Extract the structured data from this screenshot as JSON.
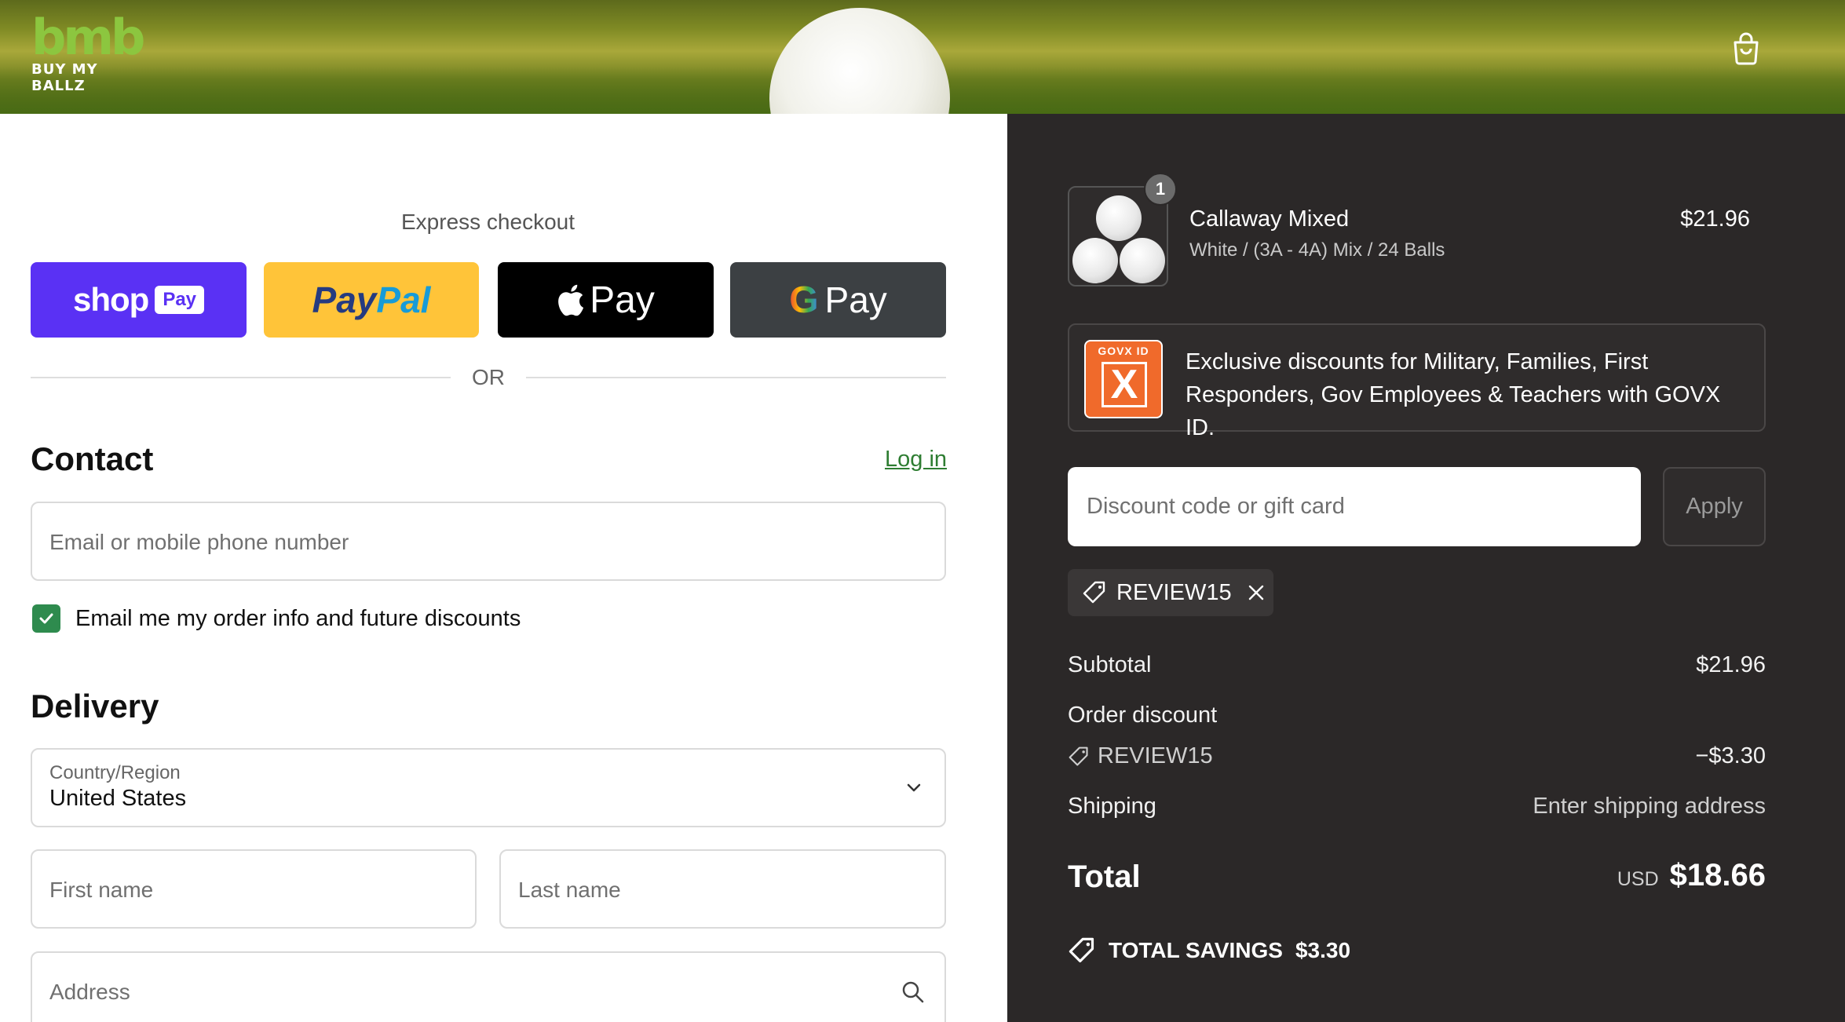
{
  "header": {
    "logo_mark": "bmb",
    "logo_tagline": "BUY MY BALLZ",
    "cart_icon": "shopping-bag-icon"
  },
  "express": {
    "title": "Express checkout",
    "shop_label": "shop",
    "shop_badge": "Pay",
    "paypal_label_1": "Pay",
    "paypal_label_2": "Pal",
    "apple_label": "Pay",
    "gpay_g": "G",
    "gpay_label": "Pay",
    "or_label": "OR"
  },
  "contact": {
    "title": "Contact",
    "login_link": "Log in",
    "email_placeholder": "Email or mobile phone number",
    "marketing_checkbox_label": "Email me my order info and future discounts",
    "marketing_checked": true
  },
  "delivery": {
    "title": "Delivery",
    "country_label": "Country/Region",
    "country_value": "United States",
    "first_name_placeholder": "First name",
    "last_name_placeholder": "Last name",
    "address_placeholder": "Address"
  },
  "order": {
    "item": {
      "name": "Callaway Mixed",
      "variant": "White / (3A - 4A) Mix / 24 Balls",
      "price": "$21.96",
      "quantity": "1"
    },
    "govx": {
      "logo_text": "GOVX ID",
      "logo_letter": "X",
      "message": "Exclusive discounts for Military, Families, First Responders, Gov Employees & Teachers with GOVX ID."
    },
    "discount": {
      "placeholder": "Discount code or gift card",
      "apply_label": "Apply",
      "applied_code": "REVIEW15"
    },
    "summary": {
      "subtotal_label": "Subtotal",
      "subtotal_value": "$21.96",
      "order_discount_label": "Order discount",
      "discount_code": "REVIEW15",
      "discount_value": "−$3.30",
      "shipping_label": "Shipping",
      "shipping_value": "Enter shipping address",
      "total_label": "Total",
      "currency": "USD",
      "total_value": "$18.66",
      "savings_label": "TOTAL SAVINGS",
      "savings_value": "$3.30"
    }
  },
  "colors": {
    "shop_pay": "#5a31f4",
    "paypal": "#ffc439",
    "link_green": "#2e7d32",
    "checkbox_green": "#2e8b4e",
    "summary_bg": "#2b2828",
    "govx_orange": "#f06a2b"
  }
}
